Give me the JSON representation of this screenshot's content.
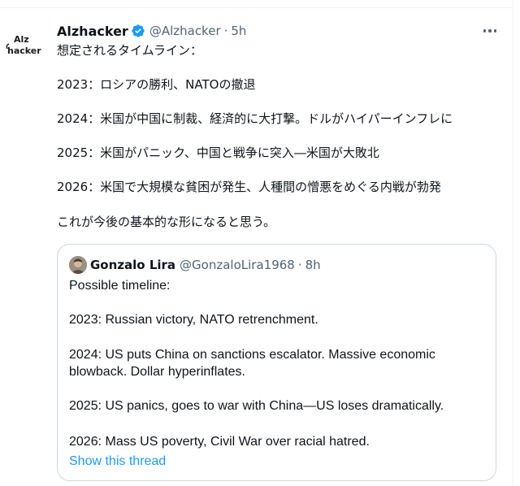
{
  "tweet": {
    "avatar_icon": "alzhacker-logo-icon",
    "display_name": "Alzhacker",
    "verified_icon": "verified-badge-icon",
    "handle": "@Alzhacker",
    "separator": "·",
    "time": "5h",
    "more_icon": "more-options-icon",
    "text_lines": [
      "想定されるタイムライン：",
      "",
      "2023：ロシアの勝利、NATOの撤退",
      "",
      "2024：米国が中国に制裁、経済的に大打撃。ドルがハイパーインフレに",
      "",
      "2025：米国がパニック、中国と戦争に突入―米国が大敗北",
      "",
      "2026：米国で大規模な貧困が発生、人種間の憎悪をめぐる内戦が勃発",
      "",
      "これが今後の基本的な形になると思う。"
    ]
  },
  "quoted_tweet": {
    "display_name": "Gonzalo Lira",
    "handle": "@GonzaloLira1968",
    "separator": "·",
    "time": "8h",
    "text_lines": [
      "Possible timeline:",
      "",
      "2023: Russian victory, NATO retrenchment.",
      "",
      "2024: US puts China on sanctions escalator. Massive economic",
      "blowback. Dollar hyperinflates.",
      "",
      "2025: US panics, goes to war with China—US loses dramatically.",
      "",
      "2026: Mass US poverty, Civil War over racial hatred."
    ],
    "show_thread_label": "Show this thread"
  },
  "colors": {
    "accent": "#1d9bf0",
    "secondary_text": "#536471",
    "border": "#cfd9de"
  }
}
